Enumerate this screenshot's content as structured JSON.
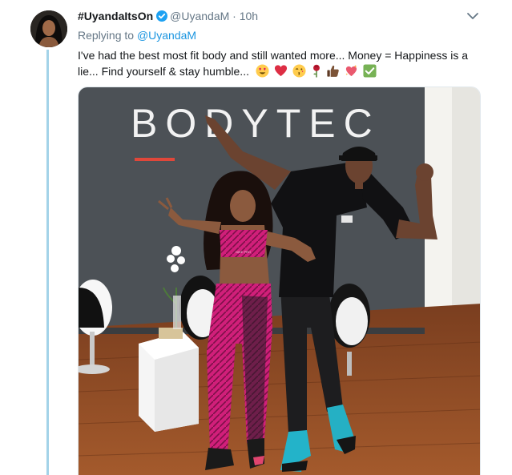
{
  "tweet": {
    "display_name": "#UyandaItsOn",
    "handle": "@UyandaM",
    "separator": "·",
    "time": "10h",
    "replying_prefix": "Replying to",
    "replying_handle": "@UyandaM",
    "text": "I've had the best most fit body and still wanted more... Money = Happiness is a lie... Find yourself & stay humble...",
    "emojis": [
      "heart-eyes-emoji",
      "red-heart-emoji",
      "kiss-emoji",
      "rose-emoji",
      "thumbs-up-emoji",
      "sparkling-heart-emoji",
      "check-mark-emoji"
    ]
  },
  "media": {
    "sign_text": "BODYTEC",
    "shirt_logo": "",
    "bra_logo": "NIKE PRO"
  },
  "colors": {
    "link": "#1b95e0",
    "verified": "#1da1f2",
    "secondary_text": "#657786",
    "thread_line": "#a3d3e8"
  }
}
